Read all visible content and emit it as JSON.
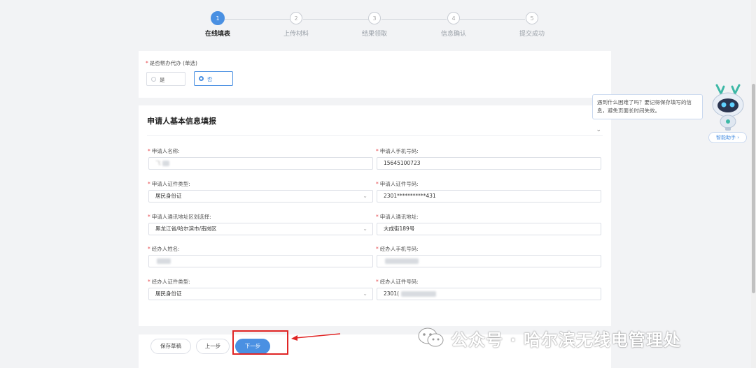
{
  "steps": [
    {
      "number": "1",
      "label": "在线填表",
      "active": true
    },
    {
      "number": "2",
      "label": "上传材料",
      "active": false
    },
    {
      "number": "3",
      "label": "结果领取",
      "active": false
    },
    {
      "number": "4",
      "label": "信息确认",
      "active": false
    },
    {
      "number": "5",
      "label": "提交成功",
      "active": false
    }
  ],
  "proxy_question": {
    "required_mark": "*",
    "label": "是否帮办代办 (单选)",
    "options": [
      {
        "label": "是",
        "selected": false
      },
      {
        "label": "否",
        "selected": true
      }
    ]
  },
  "applicant_section": {
    "title": "申请人基本信息填报",
    "collapse_icon": "chevron-down-icon",
    "fields": [
      {
        "label": "申请人名称:",
        "value": "飞",
        "type": "text",
        "blurred": true
      },
      {
        "label": "申请人手机号码:",
        "value": "15645100723",
        "type": "text"
      },
      {
        "label": "申请人证件类型:",
        "value": "居民身份证",
        "type": "select"
      },
      {
        "label": "申请人证件号码:",
        "value": "2301***********431",
        "type": "text"
      },
      {
        "label": "申请人通讯地址区划选择:",
        "value": "黑龙江省/哈尔滨市/南岗区",
        "type": "select"
      },
      {
        "label": "申请人通讯地址:",
        "value": "大成街189号",
        "type": "text"
      },
      {
        "label": "经办人姓名:",
        "value": "",
        "type": "text",
        "blurred": true
      },
      {
        "label": "经办人手机号码:",
        "value": "",
        "type": "text",
        "blurred": true
      },
      {
        "label": "经办人证件类型:",
        "value": "居民身份证",
        "type": "select"
      },
      {
        "label": "经办人证件号码:",
        "value": "2301(",
        "type": "text",
        "blurred": true
      }
    ]
  },
  "actions": {
    "save_draft": "保存草稿",
    "prev": "上一步",
    "next": "下一步"
  },
  "assistant": {
    "tip": "遇到什么困难了吗？要记得保存填写的信息，避免页面长时间失效。",
    "button": "智能助手"
  },
  "watermark": {
    "text": "公众号 · 哈尔滨无线电管理处"
  },
  "colors": {
    "accent": "#4a90e2",
    "highlight": "#e02424",
    "required": "#e5484d"
  }
}
